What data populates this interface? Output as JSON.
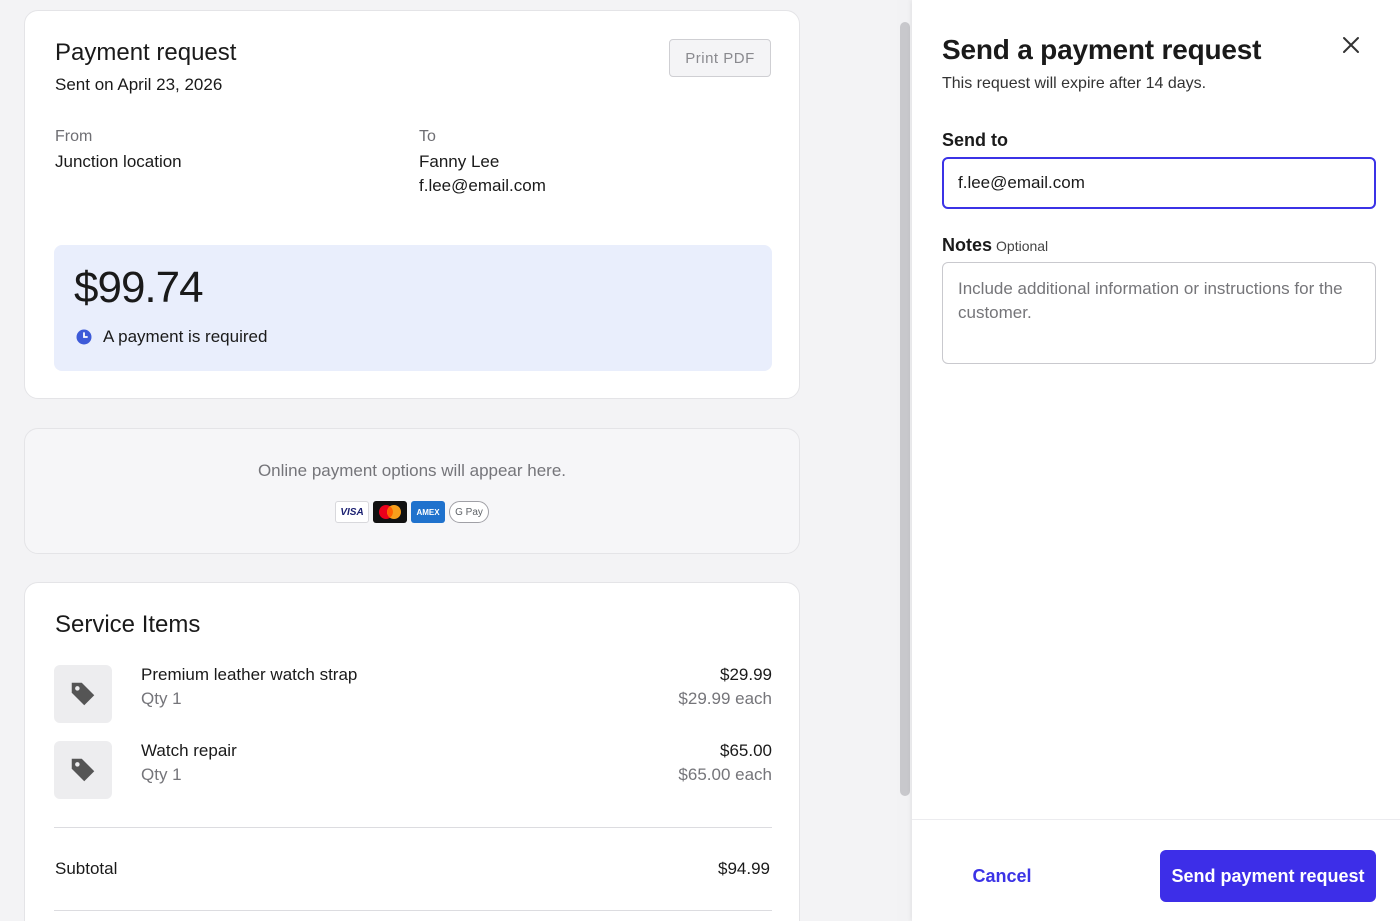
{
  "preview": {
    "request": {
      "title": "Payment request",
      "sent_on": "Sent on April 23, 2026",
      "print_label": "Print PDF",
      "from_label": "From",
      "from_name": "Junction location",
      "to_label": "To",
      "to_name": "Fanny Lee",
      "to_email": "f.lee@email.com",
      "amount": "$99.74",
      "status": "A payment is required",
      "status_icon": "clock-icon",
      "accent_color": "#3d5ad8"
    },
    "payment_options": {
      "text": "Online payment options will appear here.",
      "icons": [
        {
          "name": "visa-icon",
          "label": "VISA"
        },
        {
          "name": "mastercard-icon",
          "label": ""
        },
        {
          "name": "amex-icon",
          "label": "AMEX"
        },
        {
          "name": "google-pay-icon",
          "label": "G Pay"
        }
      ]
    },
    "service_items": {
      "title": "Service Items",
      "items": [
        {
          "name": "Premium leather watch strap",
          "qty": "Qty 1",
          "price": "$29.99",
          "each": "$29.99 each",
          "icon": "tag-icon"
        },
        {
          "name": "Watch repair",
          "qty": "Qty 1",
          "price": "$65.00",
          "each": "$65.00 each",
          "icon": "tag-icon"
        }
      ],
      "subtotal_label": "Subtotal",
      "subtotal_value": "$94.99"
    }
  },
  "panel": {
    "title": "Send a payment request",
    "subtitle": "This request will expire after 14 days.",
    "send_to_label": "Send to",
    "send_to_value": "f.lee@email.com",
    "notes_label": "Notes",
    "notes_optional": "Optional",
    "notes_placeholder": "Include additional information or instructions for the customer.",
    "cancel_label": "Cancel",
    "send_label": "Send payment request",
    "primary_color": "#3d2ee8"
  }
}
